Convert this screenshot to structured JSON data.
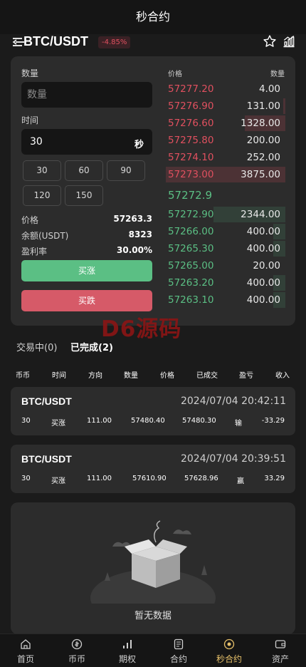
{
  "header": {
    "title": "秒合约"
  },
  "pair": {
    "name": "BTC/USDT",
    "change": "-4.85%"
  },
  "form": {
    "amount_label": "数量",
    "amount_placeholder": "数量",
    "time_label": "时间",
    "time_value": "30",
    "time_unit": "秒",
    "durations": [
      "30",
      "60",
      "90",
      "120",
      "150"
    ],
    "price_label": "价格",
    "price_value": "57263.3",
    "balance_label": "余额(USDT)",
    "balance_value": "8323",
    "profit_label": "盈利率",
    "profit_value": "30.00%",
    "buy_up_label": "买涨",
    "buy_down_label": "买跌"
  },
  "orderbook": {
    "price_header": "价格",
    "qty_header": "数量",
    "asks": [
      {
        "price": "57277.20",
        "qty": "4.00",
        "depth": 0.0
      },
      {
        "price": "57276.90",
        "qty": "131.00",
        "depth": 0.02
      },
      {
        "price": "57276.60",
        "qty": "1328.00",
        "depth": 0.34
      },
      {
        "price": "57275.80",
        "qty": "200.00",
        "depth": 0.0
      },
      {
        "price": "57274.10",
        "qty": "252.00",
        "depth": 0.0
      },
      {
        "price": "57273.00",
        "qty": "3875.00",
        "depth": 1.0
      }
    ],
    "last_price": "57272.9",
    "bids": [
      {
        "price": "57272.90",
        "qty": "2344.00",
        "depth": 0.6
      },
      {
        "price": "57266.00",
        "qty": "400.00",
        "depth": 0.1
      },
      {
        "price": "57265.30",
        "qty": "400.00",
        "depth": 0.1
      },
      {
        "price": "57265.00",
        "qty": "20.00",
        "depth": 0.0
      },
      {
        "price": "57263.20",
        "qty": "400.00",
        "depth": 0.1
      },
      {
        "price": "57263.10",
        "qty": "400.00",
        "depth": 0.1
      }
    ]
  },
  "watermark": "D6源码",
  "tabs": {
    "trading": "交易中(0)",
    "completed": "已完成(2)"
  },
  "columns": [
    "币币",
    "时间",
    "方向",
    "数量",
    "价格",
    "已成交",
    "盈亏",
    "收入"
  ],
  "orders": [
    {
      "pair": "BTC/USDT",
      "time": "2024/07/04 20:42:11",
      "duration": "30",
      "direction": "买涨",
      "amount": "111.00",
      "price": "57480.40",
      "filled": "57480.30",
      "result": "输",
      "income": "-33.29"
    },
    {
      "pair": "BTC/USDT",
      "time": "2024/07/04 20:39:51",
      "duration": "30",
      "direction": "买涨",
      "amount": "111.00",
      "price": "57610.90",
      "filled": "57628.96",
      "result": "赢",
      "income": "33.29"
    }
  ],
  "empty": {
    "text": "暂无数据"
  },
  "nav": [
    {
      "label": "首页",
      "icon": "home-icon"
    },
    {
      "label": "币币",
      "icon": "coin-icon"
    },
    {
      "label": "期权",
      "icon": "bars-icon"
    },
    {
      "label": "合约",
      "icon": "document-icon"
    },
    {
      "label": "秒合约",
      "icon": "target-icon",
      "active": true
    },
    {
      "label": "资产",
      "icon": "wallet-icon"
    }
  ],
  "colors": {
    "green": "#5bbf84",
    "red": "#e0505f",
    "accent": "#e6c06a"
  }
}
